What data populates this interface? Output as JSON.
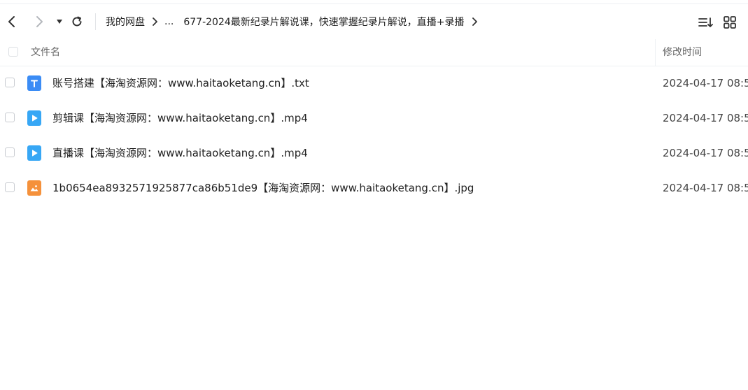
{
  "toolbar": {
    "back_icon": "chevron-left-icon",
    "forward_icon": "chevron-right-icon",
    "history_icon": "caret-down-icon",
    "refresh_icon": "refresh-icon",
    "sort_icon": "sort-list-icon",
    "grid_icon": "grid-view-icon"
  },
  "breadcrumb": {
    "root": "我的网盘",
    "ellipsis": "...",
    "current": "677-2024最新纪录片解说课，快速掌握纪录片解说，直播+录播"
  },
  "header": {
    "name_label": "文件名",
    "time_label": "修改时间"
  },
  "files": [
    {
      "name": "账号搭建【海淘资源网：www.haitaoketang.cn】.txt",
      "time": "2024-04-17 08:5",
      "type": "txt-file-icon",
      "color": "#3b8cf5"
    },
    {
      "name": "剪辑课【海淘资源网：www.haitaoketang.cn】.mp4",
      "time": "2024-04-17 08:5",
      "type": "video-file-icon",
      "color": "#37a7f5"
    },
    {
      "name": "直播课【海淘资源网：www.haitaoketang.cn】.mp4",
      "time": "2024-04-17 08:5",
      "type": "video-file-icon",
      "color": "#37a7f5"
    },
    {
      "name": "1b0654ea8932571925877ca86b51de9【海淘资源网：www.haitaoketang.cn】.jpg",
      "time": "2024-04-17 08:5",
      "type": "image-file-icon",
      "color": "#f5913b"
    }
  ]
}
